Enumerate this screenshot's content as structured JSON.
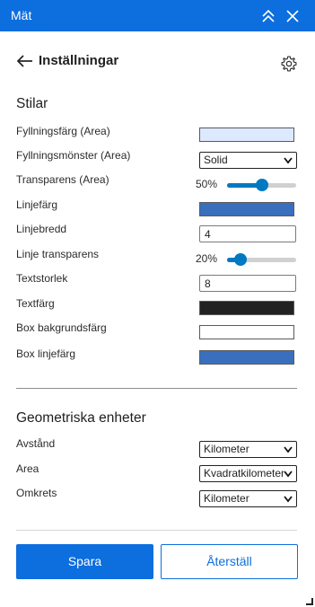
{
  "window": {
    "title": "Mät"
  },
  "header": {
    "title": "Inställningar"
  },
  "styles": {
    "section_title": "Stilar",
    "fill_color": {
      "label": "Fyllningsfärg (Area)",
      "color": "#dde9ff"
    },
    "fill_pattern": {
      "label": "Fyllningsmönster (Area)",
      "value": "Solid"
    },
    "fill_transparency": {
      "label": "Transparens (Area)",
      "value_text": "50%",
      "value": 50
    },
    "line_color": {
      "label": "Linjefärg",
      "color": "#3a6fbe"
    },
    "line_width": {
      "label": "Linjebredd",
      "value": "4"
    },
    "line_transparency": {
      "label": "Linje transparens",
      "value_text": "20%",
      "value": 20
    },
    "text_size": {
      "label": "Textstorlek",
      "value": "8"
    },
    "text_color": {
      "label": "Textfärg",
      "color": "#222222"
    },
    "box_bg_color": {
      "label": "Box bakgrundsfärg",
      "color": "#ffffff"
    },
    "box_line_color": {
      "label": "Box linjefärg",
      "color": "#3a6fbe"
    }
  },
  "units": {
    "section_title": "Geometriska enheter",
    "distance": {
      "label": "Avstånd",
      "value": "Kilometer"
    },
    "area": {
      "label": "Area",
      "value": "Kvadratkilometer"
    },
    "perimeter": {
      "label": "Omkrets",
      "value": "Kilometer"
    }
  },
  "buttons": {
    "save": "Spara",
    "reset": "Återställ"
  },
  "colors": {
    "accent": "#0d6ede",
    "slider": "#0079c1"
  }
}
